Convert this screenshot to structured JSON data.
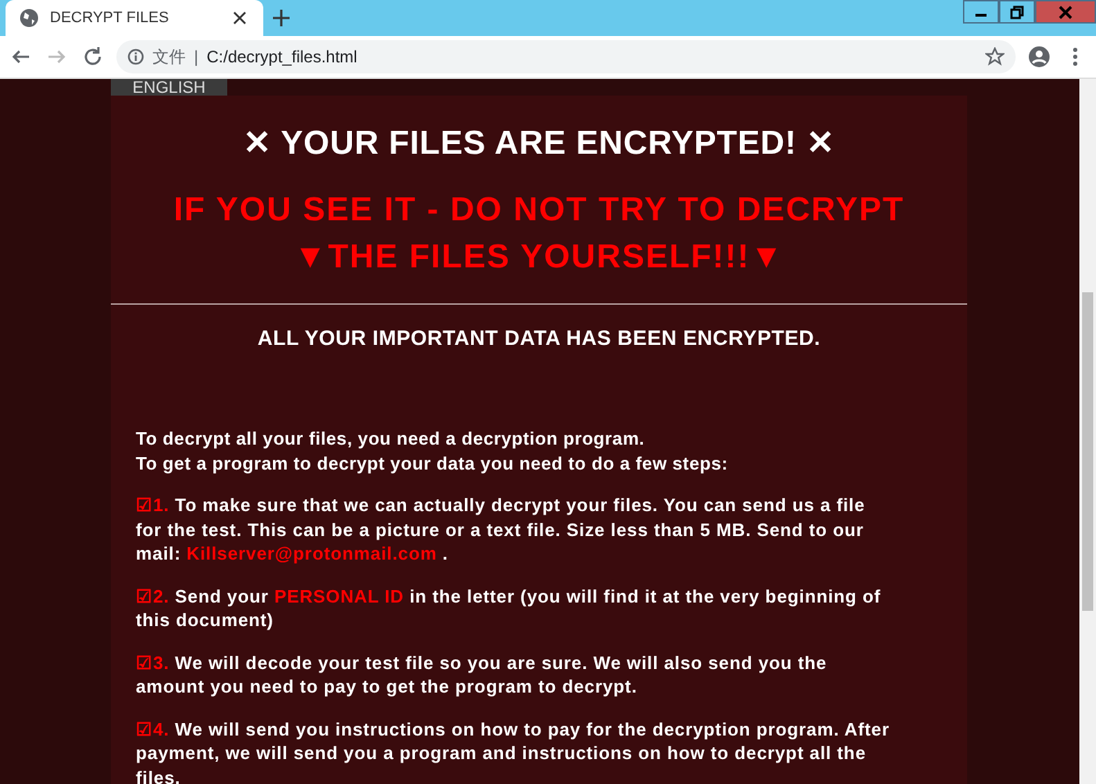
{
  "browser": {
    "tab": {
      "title": "DECRYPT FILES",
      "selected": true
    },
    "address": {
      "scheme_label": "文件",
      "separator": "|",
      "url": "C:/decrypt_files.html"
    },
    "forward_disabled": true
  },
  "page": {
    "language_button": "ENGLISH",
    "title": "✕ YOUR FILES ARE ENCRYPTED! ✕",
    "warning": [
      "IF YOU SEE IT - DO NOT TRY TO DECRYPT",
      "▼THE FILES YOURSELF!!!▼"
    ],
    "subtitle": "ALL YOUR IMPORTANT DATA HAS BEEN ENCRYPTED.",
    "intro": [
      "To decrypt all your files, you need a decryption program.",
      "To get a program to decrypt your data you need to do a few steps:"
    ],
    "steps": [
      {
        "number": "☑1.",
        "parts": [
          {
            "text": "To make sure that we can actually decrypt your files. You can send us a file for the test. This can be a picture or a text file. Size less than 5 MB. Send to our mail: ",
            "highlight": false
          },
          {
            "text": "Killserver@protonmail.com",
            "highlight": true
          },
          {
            "text": " .",
            "highlight": false
          }
        ]
      },
      {
        "number": "☑2.",
        "parts": [
          {
            "text": "Send your ",
            "highlight": false
          },
          {
            "text": "PERSONAL ID",
            "highlight": true
          },
          {
            "text": " in the letter (you will find it at the very beginning of this document)",
            "highlight": false
          }
        ]
      },
      {
        "number": "☑3.",
        "parts": [
          {
            "text": "We will decode your test file so you are sure. We will also send you the amount you need to pay to get the program to decrypt.",
            "highlight": false
          }
        ]
      },
      {
        "number": "☑4.",
        "parts": [
          {
            "text": "We will send you instructions on how to pay for the decryption program. After payment, we will send you a program and instructions on how to decrypt all the files.",
            "highlight": false
          }
        ]
      }
    ]
  }
}
